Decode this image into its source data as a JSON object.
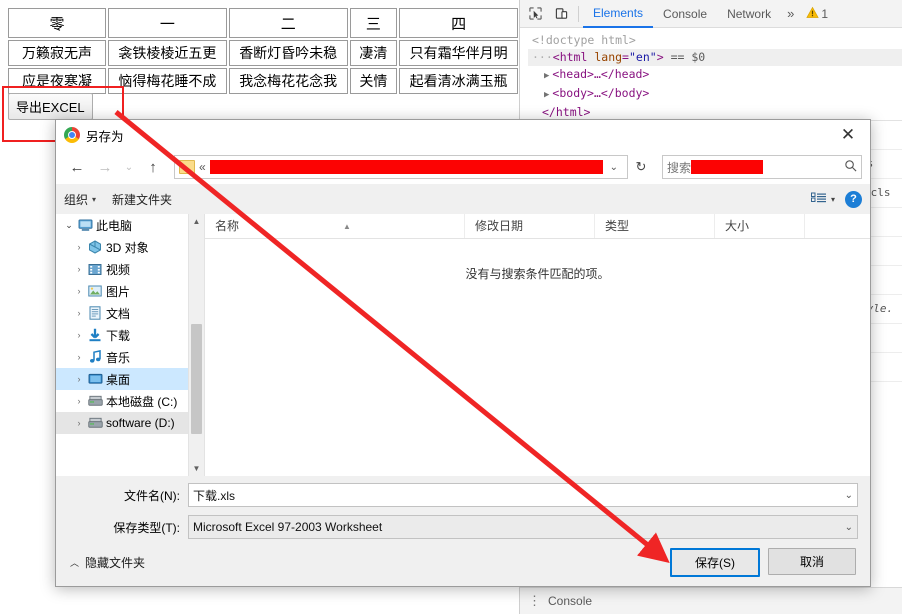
{
  "webpage": {
    "table": {
      "headers": [
        "零",
        "一",
        "二",
        "三",
        "四"
      ],
      "rows": [
        [
          "万籁寂无声",
          "衾铁棱棱近五更",
          "香断灯昏吟未稳",
          "凄清",
          "只有霜华伴月明"
        ],
        [
          "应是夜寒凝",
          "恼得梅花睡不成",
          "我念梅花花念我",
          "关情",
          "起看清冰满玉瓶"
        ]
      ]
    },
    "export_button": "导出EXCEL"
  },
  "devtools": {
    "tabs": [
      {
        "label": "Elements",
        "active": true
      },
      {
        "label": "Console",
        "active": false
      },
      {
        "label": "Network",
        "active": false
      }
    ],
    "more_label": "»",
    "warning_count": "1",
    "icons": {
      "inspect": "inspect-element-icon",
      "device": "device-toolbar-icon",
      "warning": "warning-triangle-icon"
    },
    "dom_tree": {
      "doctype": "<!doctype html>",
      "html_open_tag": "<html",
      "html_attr_name": "lang",
      "html_attr_value": "\"en\"",
      "html_close_bracket": ">",
      "selected_marker": "== $0",
      "head_line": "<head>…</head>",
      "body_line": "<body>…</body>",
      "html_close": "</html>"
    },
    "styles_fragments": [
      "ts",
      ".cls",
      "tyle."
    ],
    "drawer_label": "Console"
  },
  "dialog": {
    "title": "另存为",
    "close_glyph": "✕",
    "nav": {
      "back": "←",
      "forward": "→",
      "recent": "⌄",
      "up": "↑",
      "breadcrumb_collapse": "«",
      "address_redacted": true,
      "address_caret": "⌄",
      "refresh": "↻",
      "search_placeholder": "搜索",
      "search_icon": "search-icon"
    },
    "commands": {
      "organize": "组织",
      "organize_caret": "▾",
      "new_folder": "新建文件夹",
      "view_caret": "▾",
      "help": "?"
    },
    "tree": [
      {
        "label": "此电脑",
        "icon": "computer-icon",
        "expanded": true,
        "indent": 0,
        "state": "normal"
      },
      {
        "label": "3D 对象",
        "icon": "3d-objects-icon",
        "expanded": false,
        "indent": 1,
        "state": "normal"
      },
      {
        "label": "视频",
        "icon": "videos-icon",
        "expanded": false,
        "indent": 1,
        "state": "normal"
      },
      {
        "label": "图片",
        "icon": "pictures-icon",
        "expanded": false,
        "indent": 1,
        "state": "normal"
      },
      {
        "label": "文档",
        "icon": "documents-icon",
        "expanded": false,
        "indent": 1,
        "state": "normal"
      },
      {
        "label": "下载",
        "icon": "downloads-icon",
        "expanded": false,
        "indent": 1,
        "state": "normal"
      },
      {
        "label": "音乐",
        "icon": "music-icon",
        "expanded": false,
        "indent": 1,
        "state": "normal"
      },
      {
        "label": "桌面",
        "icon": "desktop-icon",
        "expanded": false,
        "indent": 1,
        "state": "selected"
      },
      {
        "label": "本地磁盘 (C:)",
        "icon": "drive-icon",
        "expanded": false,
        "indent": 1,
        "state": "normal"
      },
      {
        "label": "software (D:)",
        "icon": "drive-icon",
        "expanded": false,
        "indent": 1,
        "state": "hover"
      }
    ],
    "list_columns": [
      "名称",
      "修改日期",
      "类型",
      "大小"
    ],
    "empty_message": "没有与搜索条件匹配的项。",
    "filename_label": "文件名(N):",
    "filename_value": "下载.xls",
    "filetype_label": "保存类型(T):",
    "filetype_value": "Microsoft Excel 97-2003 Worksheet",
    "hide_folders": "隐藏文件夹",
    "hide_folders_caret": "︿",
    "save_button": "保存(S)",
    "cancel_button": "取消"
  },
  "annotations": {
    "rect_color": "#f02020",
    "arrow_color": "#ef2525"
  }
}
